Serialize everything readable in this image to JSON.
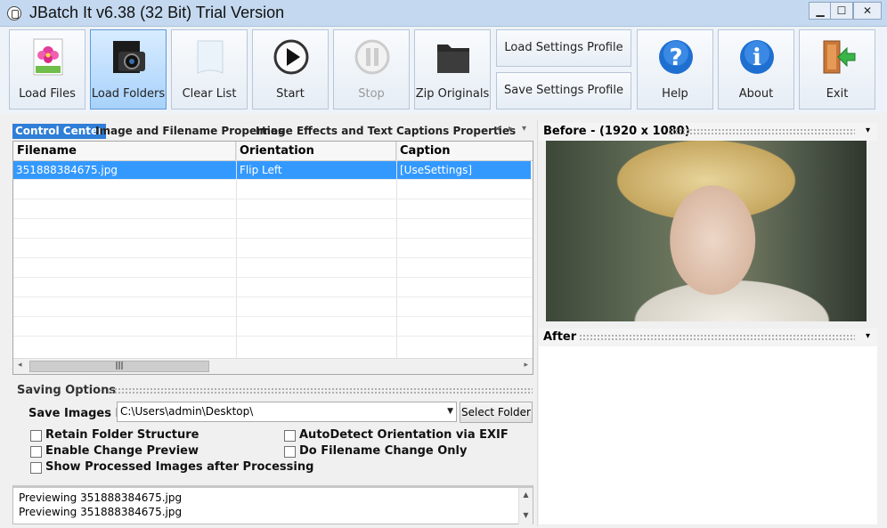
{
  "window": {
    "title": "JBatch It v6.38 (32 Bit) Trial Version",
    "minimize": "▁",
    "maximize": "☐",
    "close": "✕"
  },
  "toolbar": {
    "load_files": "Load Files",
    "load_folders": "Load Folders",
    "clear_list": "Clear List",
    "start": "Start",
    "stop": "Stop",
    "zip_originals": "Zip Originals",
    "load_settings_profile": "Load Settings Profile",
    "save_settings_profile": "Save Settings Profile",
    "help": "Help",
    "about": "About",
    "exit": "Exit"
  },
  "tabs": [
    {
      "label": "Control Center"
    },
    {
      "label": "Image and Filename Properties"
    },
    {
      "label": "Image Effects and Text Captions Properties"
    }
  ],
  "tab_nav": {
    "left": "◂",
    "right": "▸",
    "menu": "▾"
  },
  "grid": {
    "columns": [
      "Filename",
      "Orientation",
      "Caption"
    ],
    "rows": [
      {
        "filename": "351888384675.jpg",
        "orientation": "Flip Left",
        "caption": "[UseSettings]"
      }
    ],
    "scroll_left": "◂",
    "scroll_right": "▸",
    "scroll_grip": "|||"
  },
  "saving_options": {
    "title": "Saving Options",
    "save_images_in_label": "Save Images In",
    "save_path": "C:\\Users\\admin\\Desktop\\",
    "select_folder": "Select Folder",
    "checkboxes": [
      {
        "label": "Retain Folder Structure",
        "checked": false
      },
      {
        "label": "Enable Change Preview",
        "checked": false
      },
      {
        "label": "Show Processed Images after Processing",
        "checked": false
      },
      {
        "label": "AutoDetect Orientation via EXIF",
        "checked": false
      },
      {
        "label": "Do Filename Change Only",
        "checked": false
      }
    ]
  },
  "log": {
    "lines": [
      "Previewing 351888384675.jpg",
      "Previewing 351888384675.jpg"
    ],
    "up": "▲",
    "down": "▼"
  },
  "preview": {
    "before_title": "Before - (1920 x 1080)",
    "after_title": "After",
    "menu": "▾"
  }
}
